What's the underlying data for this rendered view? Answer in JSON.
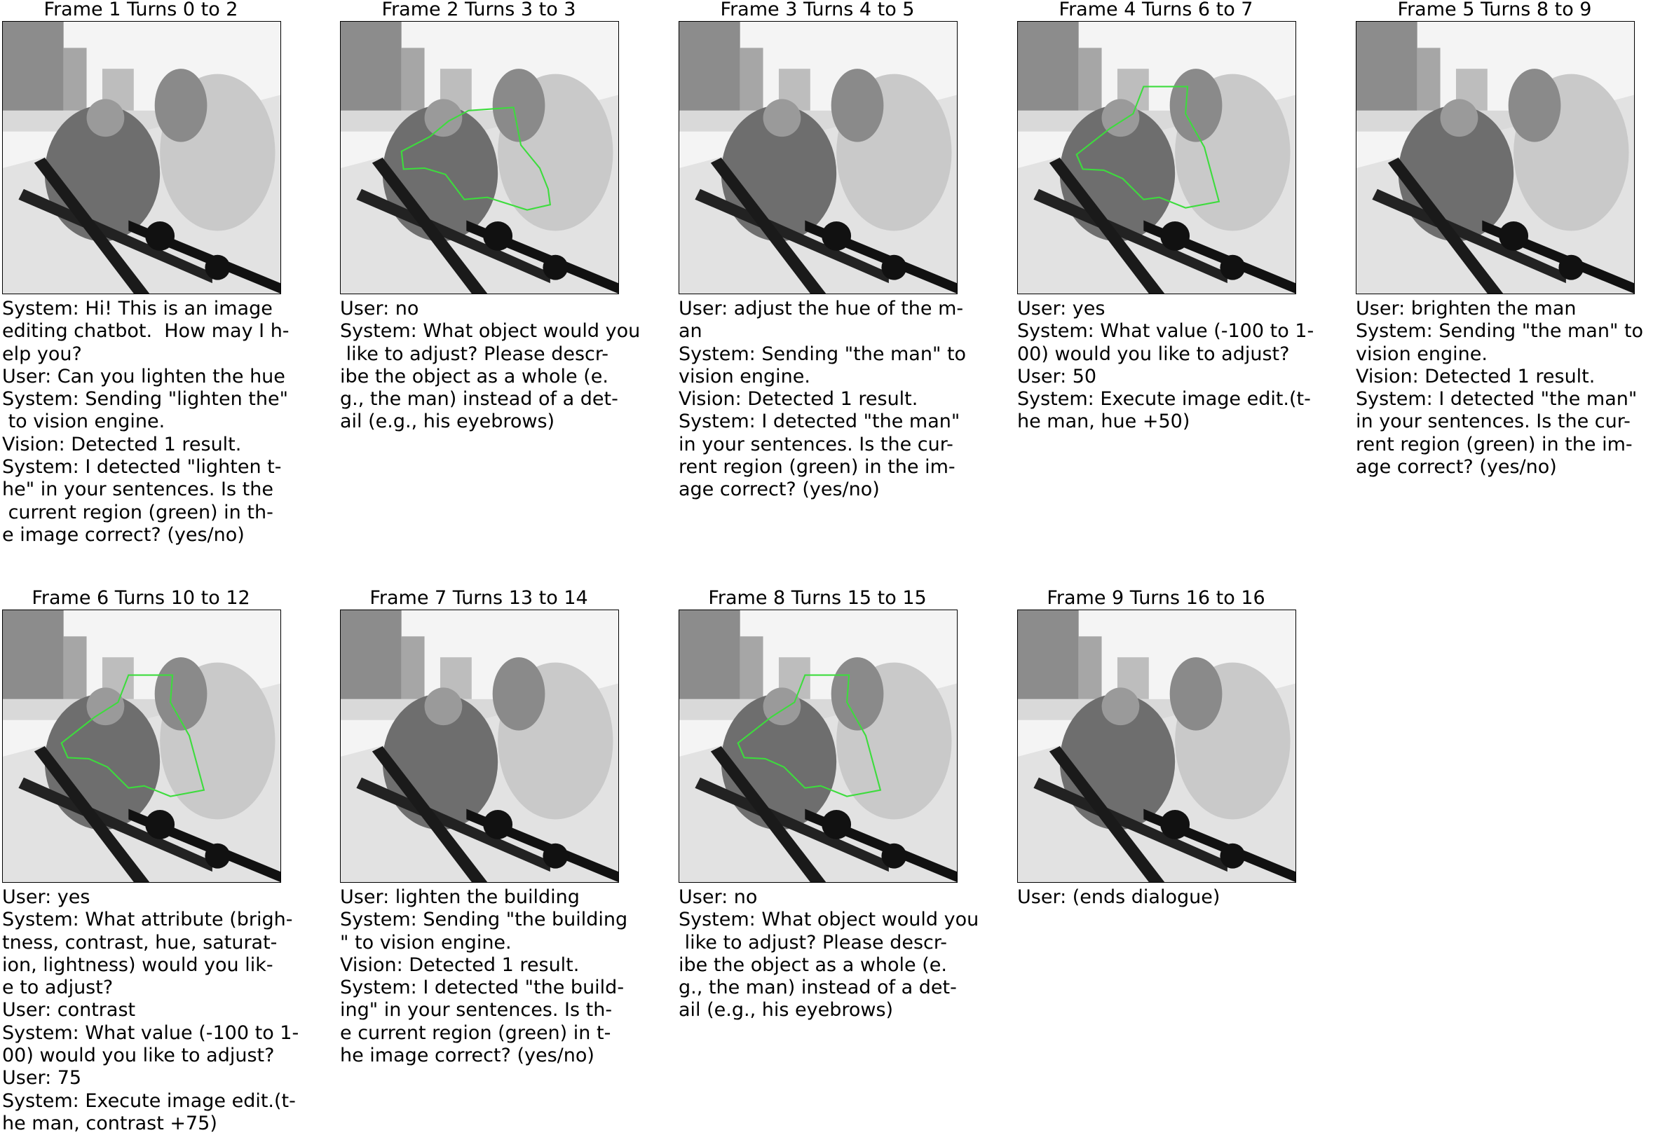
{
  "frames": [
    {
      "title": "Frame 1 Turns 0 to 2",
      "highlight": false,
      "lines": [
        "System: Hi! This is an image",
        "editing chatbot.  How may I h-",
        "elp you?",
        "User: Can you lighten the hue",
        "System: Sending \"lighten the\"",
        " to vision engine.",
        "Vision: Detected 1 result.",
        "System: I detected \"lighten t-",
        "he\" in your sentences. Is the",
        " current region (green) in th-",
        "e image correct? (yes/no)"
      ]
    },
    {
      "title": "Frame 2 Turns 3 to 3",
      "highlight": "region-a",
      "lines": [
        "User: no",
        "System: What object would you",
        " like to adjust? Please descr-",
        "ibe the object as a whole (e.",
        "g., the man) instead of a det-",
        "ail (e.g., his eyebrows)"
      ]
    },
    {
      "title": "Frame 3 Turns 4 to 5",
      "highlight": false,
      "lines": [
        "User: adjust the hue of the m-",
        "an",
        "System: Sending \"the man\" to",
        "vision engine.",
        "Vision: Detected 1 result.",
        "System: I detected \"the man\"",
        "in your sentences. Is the cur-",
        "rent region (green) in the im-",
        "age correct? (yes/no)"
      ]
    },
    {
      "title": "Frame 4 Turns 6 to 7",
      "highlight": "region-b",
      "lines": [
        "User: yes",
        "System: What value (-100 to 1-",
        "00) would you like to adjust?",
        "User: 50",
        "System: Execute image edit.(t-",
        "he man, hue +50)"
      ]
    },
    {
      "title": "Frame 5 Turns 8 to 9",
      "highlight": false,
      "lines": [
        "User: brighten the man",
        "System: Sending \"the man\" to",
        "vision engine.",
        "Vision: Detected 1 result.",
        "System: I detected \"the man\"",
        "in your sentences. Is the cur-",
        "rent region (green) in the im-",
        "age correct? (yes/no)"
      ]
    },
    {
      "title": "Frame 6 Turns 10 to 12",
      "highlight": "region-b",
      "lines": [
        "User: yes",
        "System: What attribute (brigh-",
        "tness, contrast, hue, saturat-",
        "ion, lightness) would you lik-",
        "e to adjust?",
        "User: contrast",
        "System: What value (-100 to 1-",
        "00) would you like to adjust?",
        "User: 75",
        "System: Execute image edit.(t-",
        "he man, contrast +75)"
      ]
    },
    {
      "title": "Frame 7 Turns 13 to 14",
      "highlight": false,
      "lines": [
        "User: lighten the building",
        "System: Sending \"the building",
        "\" to vision engine.",
        "Vision: Detected 1 result.",
        "System: I detected \"the build-",
        "ing\" in your sentences. Is th-",
        "e current region (green) in t-",
        "he image correct? (yes/no)"
      ]
    },
    {
      "title": "Frame 8 Turns 15 to 15",
      "highlight": "region-b",
      "lines": [
        "User: no",
        "System: What object would you",
        " like to adjust? Please descr-",
        "ibe the object as a whole (e.",
        "g., the man) instead of a det-",
        "ail (e.g., his eyebrows)"
      ]
    },
    {
      "title": "Frame 9 Turns 16 to 16",
      "highlight": false,
      "lines": [
        "User: (ends dialogue)"
      ]
    }
  ],
  "colors": {
    "highlight": "#3ddc3d",
    "text": "#000000",
    "background": "#ffffff"
  }
}
